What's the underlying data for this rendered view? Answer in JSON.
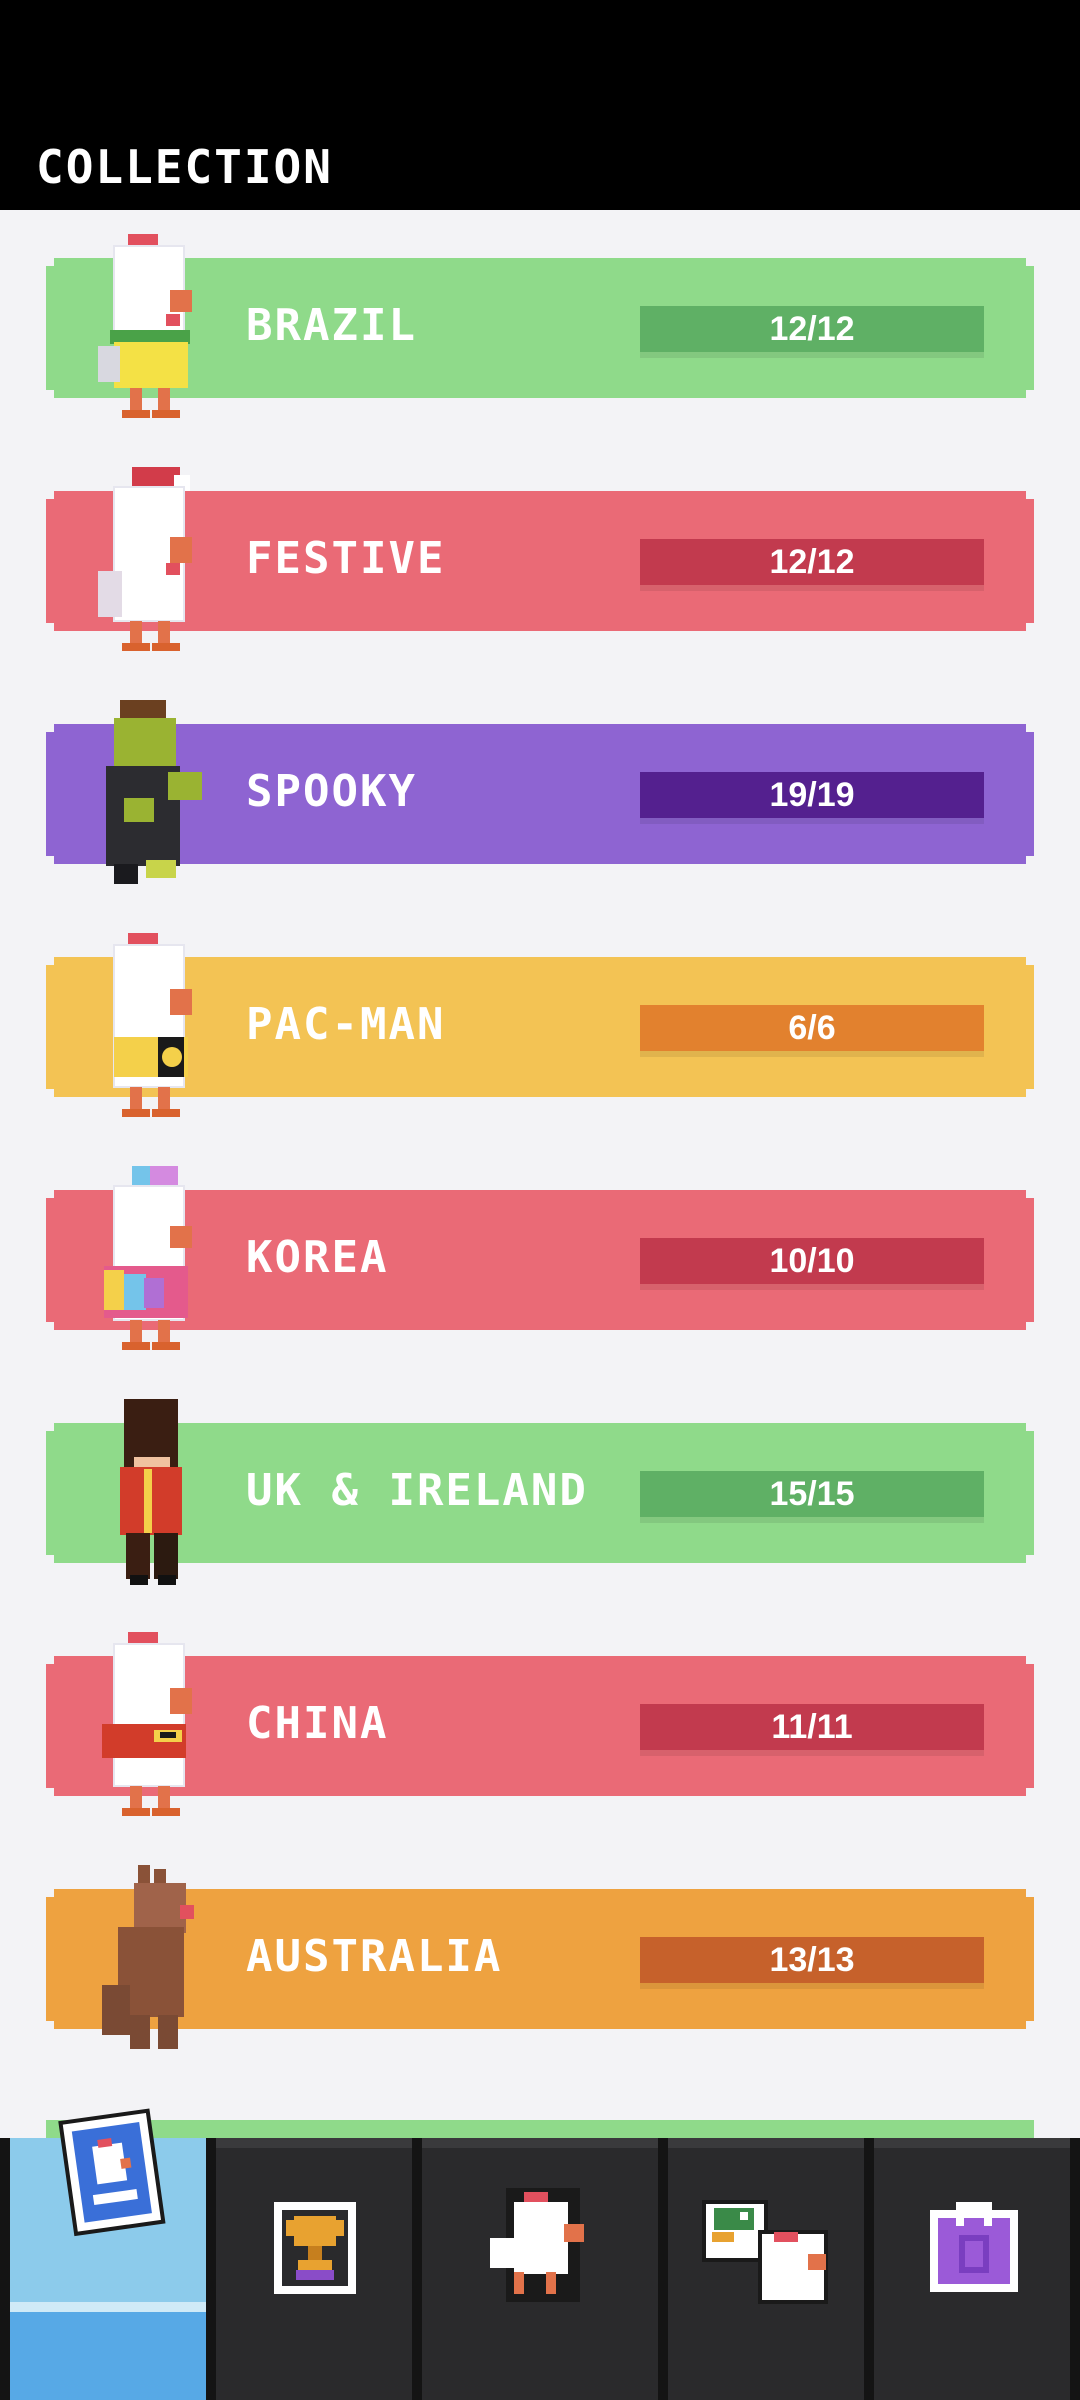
{
  "header": {
    "title": "COLLECTION"
  },
  "collections": [
    {
      "label": "BRAZIL",
      "progress": "12/12",
      "band_color": "#8fda8a",
      "bar_color": "#5fb065",
      "character": "chicken-brazil-icon"
    },
    {
      "label": "FESTIVE",
      "progress": "12/12",
      "band_color": "#ea6a76",
      "bar_color": "#c23a4e",
      "character": "chicken-festive-icon"
    },
    {
      "label": "SPOOKY",
      "progress": "19/19",
      "band_color": "#8e64d2",
      "bar_color": "#54208f",
      "character": "zombie-spooky-icon"
    },
    {
      "label": "PAC-MAN",
      "progress": "6/6",
      "band_color": "#f3c354",
      "bar_color": "#e2812e",
      "character": "chicken-pacman-icon"
    },
    {
      "label": "KOREA",
      "progress": "10/10",
      "band_color": "#ea6a76",
      "bar_color": "#c23a4e",
      "character": "chicken-korea-icon"
    },
    {
      "label": "UK & IRELAND",
      "progress": "15/15",
      "band_color": "#8fda8a",
      "bar_color": "#5fb065",
      "character": "royal-guard-uk-icon"
    },
    {
      "label": "CHINA",
      "progress": "11/11",
      "band_color": "#ea6a76",
      "bar_color": "#c23a4e",
      "character": "chicken-china-icon"
    },
    {
      "label": "AUSTRALIA",
      "progress": "13/13",
      "band_color": "#eea240",
      "bar_color": "#c6612b",
      "character": "kangaroo-australia-icon"
    }
  ],
  "nav": {
    "tabs": [
      {
        "name": "collection",
        "icon": "collection-card-icon",
        "active": true
      },
      {
        "name": "trophies",
        "icon": "trophy-icon",
        "active": false
      },
      {
        "name": "characters",
        "icon": "chicken-icon",
        "active": false
      },
      {
        "name": "friends",
        "icon": "duck-and-chicken-icon",
        "active": false
      },
      {
        "name": "shop",
        "icon": "shopping-bag-icon",
        "active": false
      }
    ]
  }
}
